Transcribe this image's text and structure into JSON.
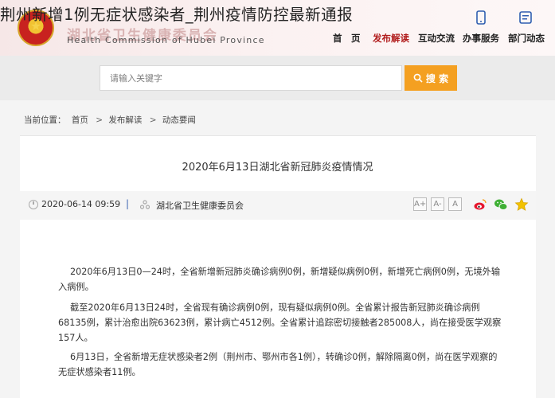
{
  "overlay_title": "荆州新增1例无症状感染者_荆州疫情防控最新通报",
  "header": {
    "org_name_cn": "湖北省卫生健康委员会",
    "org_name_en": "Health Commission of Hubei Province",
    "icons": [
      "emblem-icon",
      "mobile-icon",
      "weixin-icon"
    ]
  },
  "nav": {
    "items": [
      {
        "label": "首　页",
        "active": false
      },
      {
        "label": "发布解读",
        "active": true
      },
      {
        "label": "互动交流",
        "active": false
      },
      {
        "label": "办事服务",
        "active": false
      },
      {
        "label": "部门动态",
        "active": false
      }
    ]
  },
  "search": {
    "placeholder": "请输入关键字",
    "button_label": "搜 索"
  },
  "breadcrumb": {
    "prefix": "当前位置：",
    "items": [
      "首页",
      "发布解读",
      "动态要闻"
    ]
  },
  "article": {
    "title": "2020年6月13日湖北省新冠肺炎疫情情况",
    "date": "2020-06-14 09:59",
    "separator": "|",
    "source": "湖北省卫生健康委员会",
    "font_size_buttons": [
      "A+",
      "A-",
      "A"
    ],
    "share_icons": [
      "weibo-icon",
      "wechat-icon",
      "favorite-star-icon"
    ],
    "paragraphs": [
      "2020年6月13日0—24时，全省新增新冠肺炎确诊病例0例，新增疑似病例0例，新增死亡病例0例，无境外输入病例。",
      "截至2020年6月13日24时，全省现有确诊病例0例，现有疑似病例0例。全省累计报告新冠肺炎确诊病例68135例，累计治愈出院63623例，累计病亡4512例。全省累计追踪密切接触者285008人，尚在接受医学观察157人。",
      "6月13日，全省新增无症状感染者2例（荆州市、鄂州市各1例），转确诊0例，解除隔离0例，尚在医学观察的无症状感染者11例。"
    ]
  },
  "colors": {
    "accent_orange": "#f4a021",
    "active_nav_red": "#b21f1f",
    "separator_blue": "#3a62b1"
  }
}
